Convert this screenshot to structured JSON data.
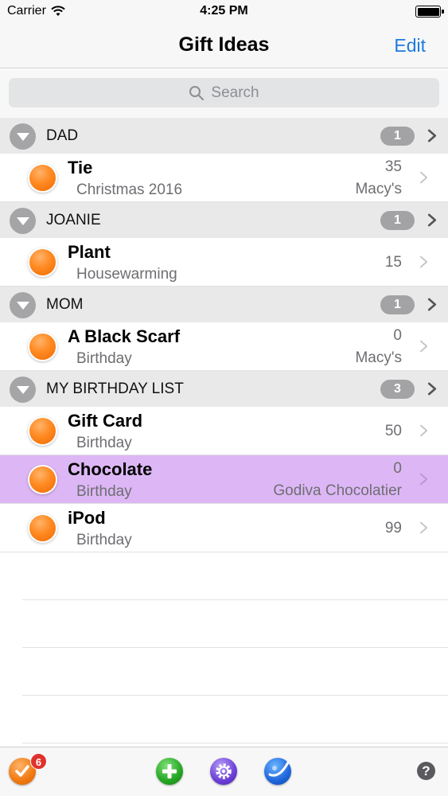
{
  "status_bar": {
    "carrier": "Carrier",
    "time": "4:25 PM"
  },
  "nav": {
    "title": "Gift Ideas",
    "edit_label": "Edit"
  },
  "search": {
    "placeholder": "Search"
  },
  "sections": [
    {
      "name": "DAD",
      "count": "1",
      "items": [
        {
          "title": "Tie",
          "occasion": "Christmas 2016",
          "price": "35",
          "store": "Macy's",
          "selected": false
        }
      ]
    },
    {
      "name": "JOANIE",
      "count": "1",
      "items": [
        {
          "title": "Plant",
          "occasion": "Housewarming",
          "price": "15",
          "store": "",
          "selected": false
        }
      ]
    },
    {
      "name": "MOM",
      "count": "1",
      "items": [
        {
          "title": "A Black Scarf",
          "occasion": "Birthday",
          "price": "0",
          "store": "Macy's",
          "selected": false
        }
      ]
    },
    {
      "name": "MY BIRTHDAY LIST",
      "count": "3",
      "items": [
        {
          "title": "Gift Card",
          "occasion": "Birthday",
          "price": "50",
          "store": "",
          "selected": false
        },
        {
          "title": "Chocolate",
          "occasion": "Birthday",
          "price": "0",
          "store": "Godiva Chocolatier",
          "selected": true
        },
        {
          "title": "iPod",
          "occasion": "Birthday",
          "price": "99",
          "store": "",
          "selected": false
        }
      ]
    }
  ],
  "toolbar": {
    "badge_count": "6",
    "help_label": "?"
  },
  "colors": {
    "accent": "#1d7be0",
    "selected_row": "#ddb7f5",
    "dot": "#ff8a22"
  },
  "icons": [
    "wifi-icon",
    "battery-icon",
    "search-icon",
    "collapse-icon",
    "chevron-right-icon",
    "checkmark-icon",
    "add-icon",
    "gear-icon",
    "globe-icon",
    "help-icon"
  ]
}
